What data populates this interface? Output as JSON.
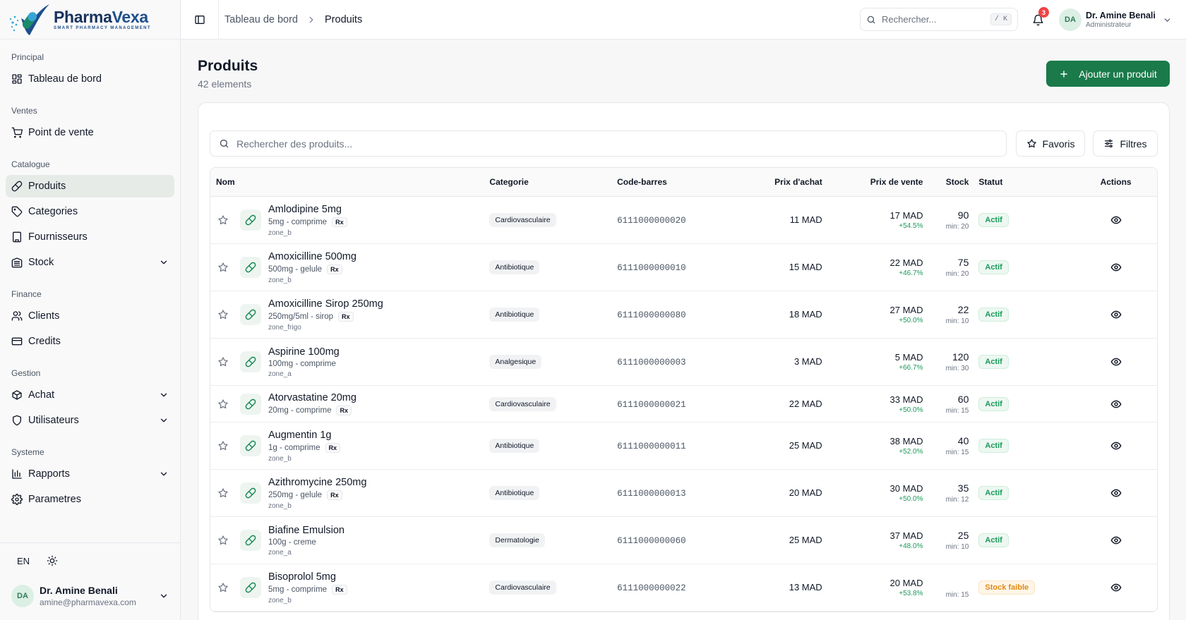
{
  "brand": {
    "name_a": "Pharma",
    "name_b": "Vexa",
    "tagline": "SMART PHARMACY MANAGEMENT"
  },
  "sidebar": {
    "sections": [
      {
        "title": "Principal",
        "items": [
          {
            "label": "Tableau de bord",
            "icon": "dashboard-icon",
            "active": false,
            "chevron": false
          }
        ]
      },
      {
        "title": "Ventes",
        "items": [
          {
            "label": "Point de vente",
            "icon": "cart-icon",
            "active": false,
            "chevron": false
          }
        ]
      },
      {
        "title": "Catalogue",
        "items": [
          {
            "label": "Produits",
            "icon": "pill-icon",
            "active": true,
            "chevron": false
          },
          {
            "label": "Categories",
            "icon": "tag-icon",
            "active": false,
            "chevron": false
          },
          {
            "label": "Fournisseurs",
            "icon": "building-icon",
            "active": false,
            "chevron": false
          },
          {
            "label": "Stock",
            "icon": "warehouse-icon",
            "active": false,
            "chevron": true
          }
        ]
      },
      {
        "title": "Finance",
        "items": [
          {
            "label": "Clients",
            "icon": "users-icon",
            "active": false,
            "chevron": false
          },
          {
            "label": "Credits",
            "icon": "credit-card-icon",
            "active": false,
            "chevron": false
          }
        ]
      },
      {
        "title": "Gestion",
        "items": [
          {
            "label": "Achat",
            "icon": "package-icon",
            "active": false,
            "chevron": true
          },
          {
            "label": "Utilisateurs",
            "icon": "shield-icon",
            "active": false,
            "chevron": true
          }
        ]
      },
      {
        "title": "Systeme",
        "items": [
          {
            "label": "Rapports",
            "icon": "bar-chart-icon",
            "active": false,
            "chevron": true
          },
          {
            "label": "Parametres",
            "icon": "settings-icon",
            "active": false,
            "chevron": false
          }
        ]
      }
    ],
    "footer": {
      "lang": "EN",
      "user_initials": "DA",
      "user_name": "Dr. Amine Benali",
      "user_email": "amine@pharmavexa.com"
    }
  },
  "topbar": {
    "breadcrumb": [
      "Tableau de bord",
      "Produits"
    ],
    "search_placeholder": "Rechercher...",
    "search_shortcut": "/ K",
    "notif_count": "3",
    "user_initials": "DA",
    "user_name": "Dr. Amine Benali",
    "user_role": "Administrateur"
  },
  "page": {
    "title": "Produits",
    "count": "42 elements",
    "add_button": "Ajouter un produit",
    "search_placeholder": "Rechercher des produits...",
    "favorites_button": "Favoris",
    "filters_button": "Filtres"
  },
  "table": {
    "columns": [
      "Nom",
      "Categorie",
      "Code-barres",
      "Prix d'achat",
      "Prix de vente",
      "Stock",
      "Statut",
      "Actions"
    ],
    "rows": [
      {
        "name": "Amlodipine 5mg",
        "desc": "5mg - comprime",
        "rx": "Rx",
        "zone": "zone_b",
        "category": "Cardiovasculaire",
        "barcode": "6111000000020",
        "buy": "11 MAD",
        "sell": "17 MAD",
        "margin": "+54.5%",
        "stock": "90",
        "min": "min: 20",
        "status": "Actif",
        "status_type": "ok"
      },
      {
        "name": "Amoxicilline 500mg",
        "desc": "500mg - gelule",
        "rx": "Rx",
        "zone": "zone_b",
        "category": "Antibiotique",
        "barcode": "6111000000010",
        "buy": "15 MAD",
        "sell": "22 MAD",
        "margin": "+46.7%",
        "stock": "75",
        "min": "min: 20",
        "status": "Actif",
        "status_type": "ok"
      },
      {
        "name": "Amoxicilline Sirop 250mg",
        "desc": "250mg/5ml - sirop",
        "rx": "Rx",
        "zone": "zone_frigo",
        "category": "Antibiotique",
        "barcode": "6111000000080",
        "buy": "18 MAD",
        "sell": "27 MAD",
        "margin": "+50.0%",
        "stock": "22",
        "min": "min: 10",
        "status": "Actif",
        "status_type": "ok"
      },
      {
        "name": "Aspirine 100mg",
        "desc": "100mg - comprime",
        "rx": "",
        "zone": "zone_a",
        "category": "Analgesique",
        "barcode": "6111000000003",
        "buy": "3 MAD",
        "sell": "5 MAD",
        "margin": "+66.7%",
        "stock": "120",
        "min": "min: 30",
        "status": "Actif",
        "status_type": "ok"
      },
      {
        "name": "Atorvastatine 20mg",
        "desc": "20mg - comprime",
        "rx": "Rx",
        "zone": "",
        "category": "Cardiovasculaire",
        "barcode": "6111000000021",
        "buy": "22 MAD",
        "sell": "33 MAD",
        "margin": "+50.0%",
        "stock": "60",
        "min": "min: 15",
        "status": "Actif",
        "status_type": "ok"
      },
      {
        "name": "Augmentin 1g",
        "desc": "1g - comprime",
        "rx": "Rx",
        "zone": "zone_b",
        "category": "Antibiotique",
        "barcode": "6111000000011",
        "buy": "25 MAD",
        "sell": "38 MAD",
        "margin": "+52.0%",
        "stock": "40",
        "min": "min: 15",
        "status": "Actif",
        "status_type": "ok"
      },
      {
        "name": "Azithromycine 250mg",
        "desc": "250mg - gelule",
        "rx": "Rx",
        "zone": "zone_b",
        "category": "Antibiotique",
        "barcode": "6111000000013",
        "buy": "20 MAD",
        "sell": "30 MAD",
        "margin": "+50.0%",
        "stock": "35",
        "min": "min: 12",
        "status": "Actif",
        "status_type": "ok"
      },
      {
        "name": "Biafine Emulsion",
        "desc": "100g - creme",
        "rx": "",
        "zone": "zone_a",
        "category": "Dermatologie",
        "barcode": "6111000000060",
        "buy": "25 MAD",
        "sell": "37 MAD",
        "margin": "+48.0%",
        "stock": "25",
        "min": "min: 10",
        "status": "Actif",
        "status_type": "ok"
      },
      {
        "name": "Bisoprolol 5mg",
        "desc": "5mg - comprime",
        "rx": "Rx",
        "zone": "zone_b",
        "category": "Cardiovasculaire",
        "barcode": "6111000000022",
        "buy": "13 MAD",
        "sell": "20 MAD",
        "margin": "+53.8%",
        "stock": "",
        "min": "min: 15",
        "status": "Stock faible",
        "status_type": "low"
      }
    ]
  },
  "colors": {
    "brand_green": "#1a7a4a",
    "ok_green": "#1a9a5a",
    "warn_orange": "#e08a16",
    "badge_red": "#ef4444"
  }
}
